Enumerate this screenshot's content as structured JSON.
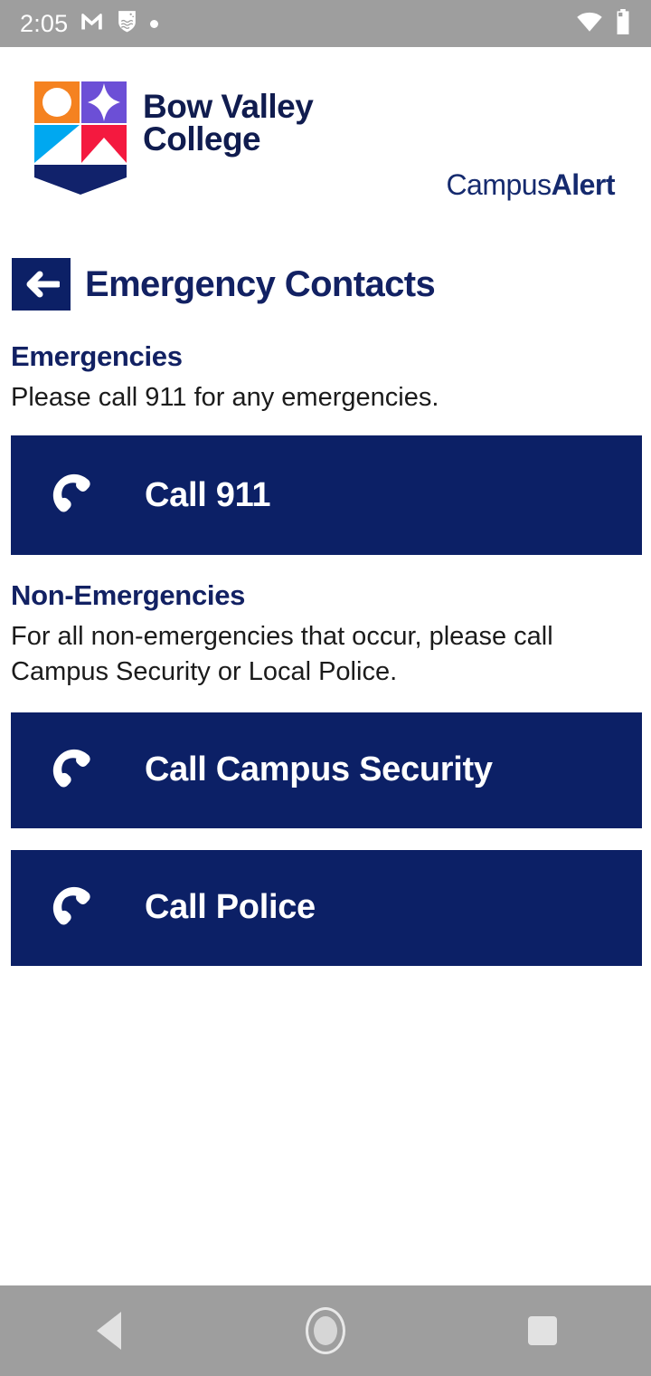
{
  "status_bar": {
    "time": "2:05",
    "left_icons": [
      "gmail-m-icon",
      "app-crest-icon",
      "dot-indicator-icon"
    ],
    "right_icons": [
      "wifi-icon",
      "battery-icon"
    ],
    "background_color": "#9e9e9e",
    "foreground_color": "#ffffff"
  },
  "brand": {
    "college_name_line1": "Bow Valley",
    "college_name_line2": "College",
    "logo_icon": "bow-valley-college-shield-icon",
    "app_name_regular": "Campus",
    "app_name_bold": "Alert",
    "navy": "#0c2066",
    "logo_colors": {
      "orange": "#f58220",
      "purple": "#6c4fd6",
      "cyan": "#00a8f0",
      "red": "#f4193f",
      "navy": "#11226b"
    }
  },
  "header": {
    "back_icon": "arrow-left-icon",
    "title": "Emergency Contacts"
  },
  "sections": [
    {
      "heading": "Emergencies",
      "body": "Please call 911 for any emergencies.",
      "buttons": [
        {
          "label": "Call 911",
          "icon": "phone-handset-icon"
        }
      ]
    },
    {
      "heading": "Non-Emergencies",
      "body": "For all non-emergencies that occur, please call Campus Security or Local Police.",
      "buttons": [
        {
          "label": "Call Campus Security",
          "icon": "phone-handset-icon"
        },
        {
          "label": "Call Police",
          "icon": "phone-handset-icon"
        }
      ]
    }
  ],
  "nav_bar": {
    "back_icon": "android-back-triangle-icon",
    "home_icon": "android-home-circle-icon",
    "recents_icon": "android-recents-square-icon",
    "background_color": "#9e9e9e"
  }
}
